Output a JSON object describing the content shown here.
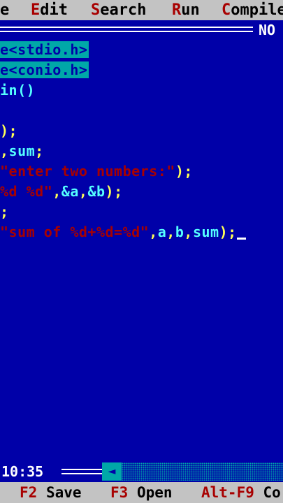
{
  "menu": {
    "items": [
      {
        "hot": "",
        "rest": "e"
      },
      {
        "hot": "E",
        "rest": "dit"
      },
      {
        "hot": "S",
        "rest": "earch"
      },
      {
        "hot": "R",
        "rest": "un"
      },
      {
        "hot": "C",
        "rest": "ompile"
      }
    ]
  },
  "window": {
    "title": "NO"
  },
  "editor": {
    "line1": "e<stdio.h>",
    "line2": "e<conio.h>",
    "line3": "in()",
    "line4": ");",
    "line5_sep": ",",
    "line5_var": "sum",
    "line5_end": ";",
    "line6_str": "\"enter two numbers:\"",
    "line6_end": ");",
    "line7_fmt": "%d %d\"",
    "line7_sep1": ",",
    "line7_a": "&a",
    "line7_sep2": ",",
    "line7_b": "&b",
    "line7_end": ");",
    "line8": ";",
    "line9_str": "\"sum of %d+%d=%d\"",
    "line9_sep1": ",",
    "line9_a": "a",
    "line9_sep2": ",",
    "line9_b": "b",
    "line9_sep3": ",",
    "line9_sum": "sum",
    "line9_end": ");"
  },
  "status": {
    "time": "10:35",
    "scroll_arrow": "◄"
  },
  "fkeys": [
    {
      "key": "F2",
      "label": "Save"
    },
    {
      "key": "F3",
      "label": "Open"
    },
    {
      "key": "Alt-F9",
      "label": "Co"
    }
  ],
  "colors": {
    "background": "#0000a8",
    "menubar": "#c3c3c3",
    "keyword": "#ffff55",
    "identifier": "#55ffff",
    "string": "#a80000",
    "selection": "#00a8a8"
  }
}
